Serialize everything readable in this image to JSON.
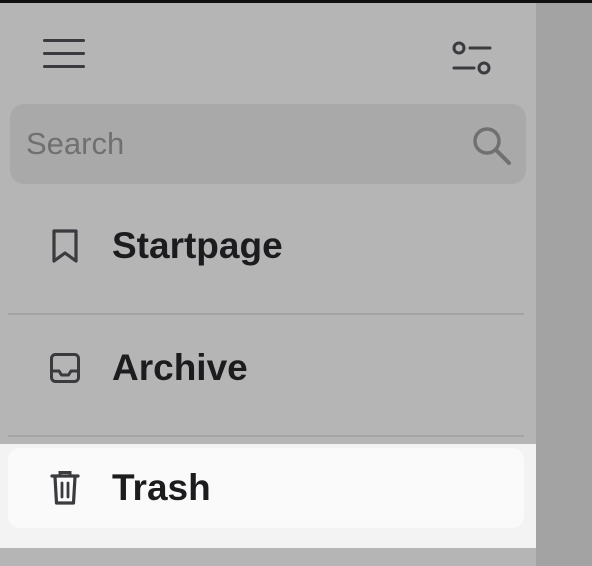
{
  "toolbar": {
    "menu_icon": "hamburger-menu-icon",
    "filter_icon": "sliders-filter-icon"
  },
  "search": {
    "placeholder": "Search",
    "value": "",
    "icon": "search-icon"
  },
  "nav": {
    "items": [
      {
        "label": "Startpage",
        "icon": "bookmark-icon",
        "selected": false
      },
      {
        "label": "Archive",
        "icon": "inbox-tray-icon",
        "selected": false
      },
      {
        "label": "Trash",
        "icon": "trash-icon",
        "selected": true
      }
    ]
  },
  "colors": {
    "sidebar_background": "#b5b5b5",
    "search_background": "#a9a9a9",
    "selected_background": "#fafafa",
    "text": "#1c1c1f",
    "icon": "#3a3a3f",
    "backdrop": "#a3a3a3"
  }
}
